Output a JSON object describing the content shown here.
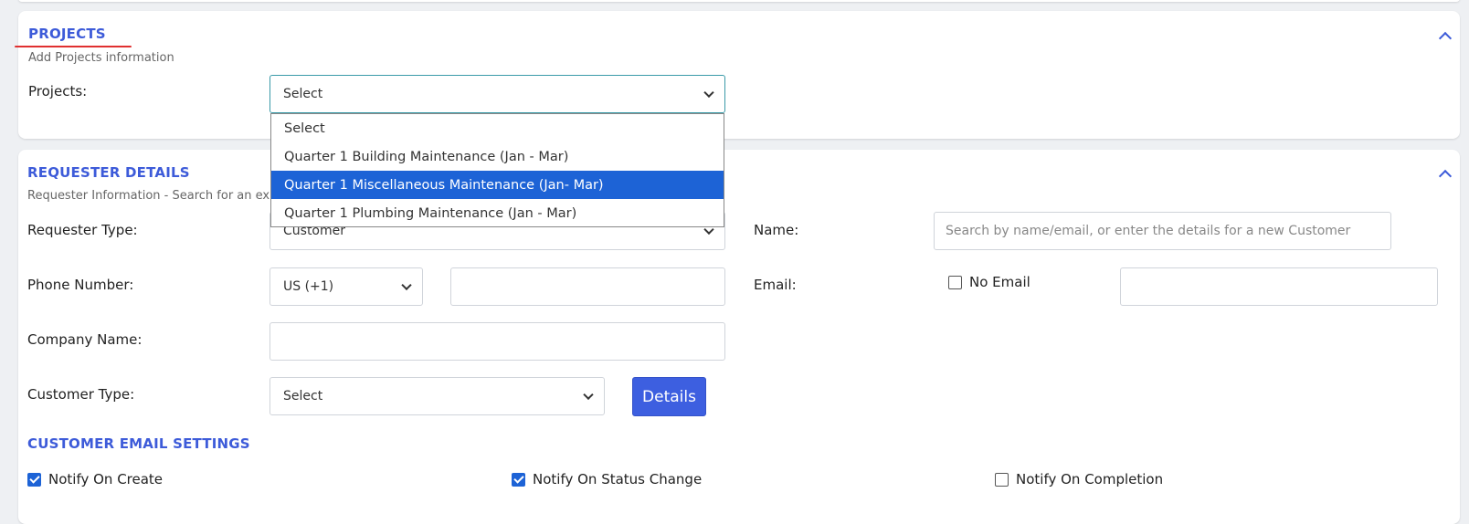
{
  "projects_section": {
    "title": "PROJECTS",
    "subtitle": "Add Projects information",
    "projects_label": "Projects:",
    "projects_select_value": "Select",
    "dropdown_options": [
      "Select",
      "Quarter 1 Building Maintenance (Jan - Mar)",
      "Quarter 1 Miscellaneous Maintenance (Jan- Mar)",
      "Quarter 1 Plumbing Maintenance (Jan - Mar)"
    ],
    "highlighted_option": "Quarter 1 Miscellaneous Maintenance (Jan- Mar)"
  },
  "requester_section": {
    "title": "REQUESTER DETAILS",
    "subtitle": "Requester Information - Search for an ex",
    "requester_type_label": "Requester Type:",
    "requester_type_value": "Customer",
    "name_label": "Name:",
    "name_placeholder": "Search by name/email, or enter the details for a new Customer",
    "phone_label": "Phone Number:",
    "phone_country_value": "US (+1)",
    "phone_value": "",
    "email_label": "Email:",
    "no_email_label": "No Email",
    "no_email_checked": false,
    "email_value": "",
    "company_label": "Company Name:",
    "company_value": "",
    "customer_type_label": "Customer Type:",
    "customer_type_value": "Select",
    "details_button": "Details"
  },
  "email_settings": {
    "title": "CUSTOMER EMAIL SETTINGS",
    "notify_create_label": "Notify On Create",
    "notify_create_checked": true,
    "notify_status_label": "Notify On Status Change",
    "notify_status_checked": true,
    "notify_completion_label": "Notify On Completion",
    "notify_completion_checked": false
  },
  "colors": {
    "accent": "#3d5bd9",
    "highlight": "#1d63d6",
    "underline": "#e03030"
  }
}
